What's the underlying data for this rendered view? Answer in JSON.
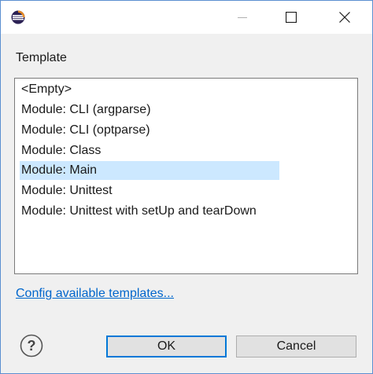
{
  "window": {
    "minimize_icon": "minimize-icon",
    "maximize_icon": "maximize-icon",
    "close_icon": "close-icon",
    "app_icon": "eclipse-icon"
  },
  "template_label": "Template",
  "templates": [
    "<Empty>",
    "Module: CLI (argparse)",
    "Module: CLI (optparse)",
    "Module: Class",
    "Module: Main",
    "Module: Unittest",
    "Module: Unittest with setUp and tearDown"
  ],
  "selected_template": "Module: Main",
  "config_link": "Config available templates...",
  "buttons": {
    "ok": "OK",
    "cancel": "Cancel",
    "help_icon": "help-icon"
  },
  "colors": {
    "selection": "#cce8ff",
    "link": "#0066cc",
    "default_button_border": "#0078d7"
  }
}
